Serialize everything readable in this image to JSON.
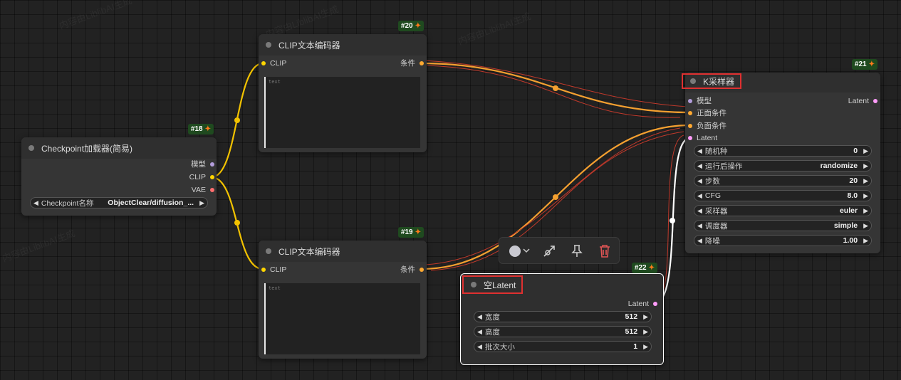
{
  "watermark": "内容由LiblibAI生成",
  "nodes": {
    "checkpoint": {
      "badge": "#18",
      "title": "Checkpoint加载器(简易)",
      "outputs": [
        "模型",
        "CLIP",
        "VAE"
      ],
      "widget": {
        "label": "Checkpoint名称",
        "value": "ObjectClear/diffusion_..."
      }
    },
    "clip_pos": {
      "badge": "#20",
      "title": "CLIP文本编码器",
      "input": "CLIP",
      "output": "条件",
      "placeholder": "text"
    },
    "clip_neg": {
      "badge": "#19",
      "title": "CLIP文本编码器",
      "input": "CLIP",
      "output": "条件",
      "placeholder": "text"
    },
    "ksampler": {
      "badge": "#21",
      "title": "K采样器",
      "inputs": [
        "模型",
        "正面条件",
        "负面条件",
        "Latent"
      ],
      "output": "Latent",
      "widgets": [
        {
          "label": "随机种",
          "value": "0"
        },
        {
          "label": "运行后操作",
          "value": "randomize"
        },
        {
          "label": "步数",
          "value": "20"
        },
        {
          "label": "CFG",
          "value": "8.0"
        },
        {
          "label": "采样器",
          "value": "euler"
        },
        {
          "label": "调度器",
          "value": "simple"
        },
        {
          "label": "降噪",
          "value": "1.00"
        }
      ]
    },
    "latent": {
      "badge": "#22",
      "title": "空Latent",
      "output": "Latent",
      "widgets": [
        {
          "label": "宽度",
          "value": "512"
        },
        {
          "label": "高度",
          "value": "512"
        },
        {
          "label": "批次大小",
          "value": "1"
        }
      ]
    }
  },
  "toolbar": {
    "icons": [
      "color-circle-icon",
      "chevron-down-icon",
      "bypass-icon",
      "pin-icon",
      "trash-icon"
    ]
  },
  "colors": {
    "clip_wire": "#f2c200",
    "cond_wire": "#f5a030",
    "latent_wire": "#ffffff",
    "pin_model": "#b39ddb",
    "pin_clip": "#ffd500",
    "pin_vae": "#ff6e6e",
    "pin_cond": "#ffa931",
    "pin_latent": "#ff9cf9",
    "highlight": "#e03030",
    "badge_bg": "#1f4a1f"
  }
}
